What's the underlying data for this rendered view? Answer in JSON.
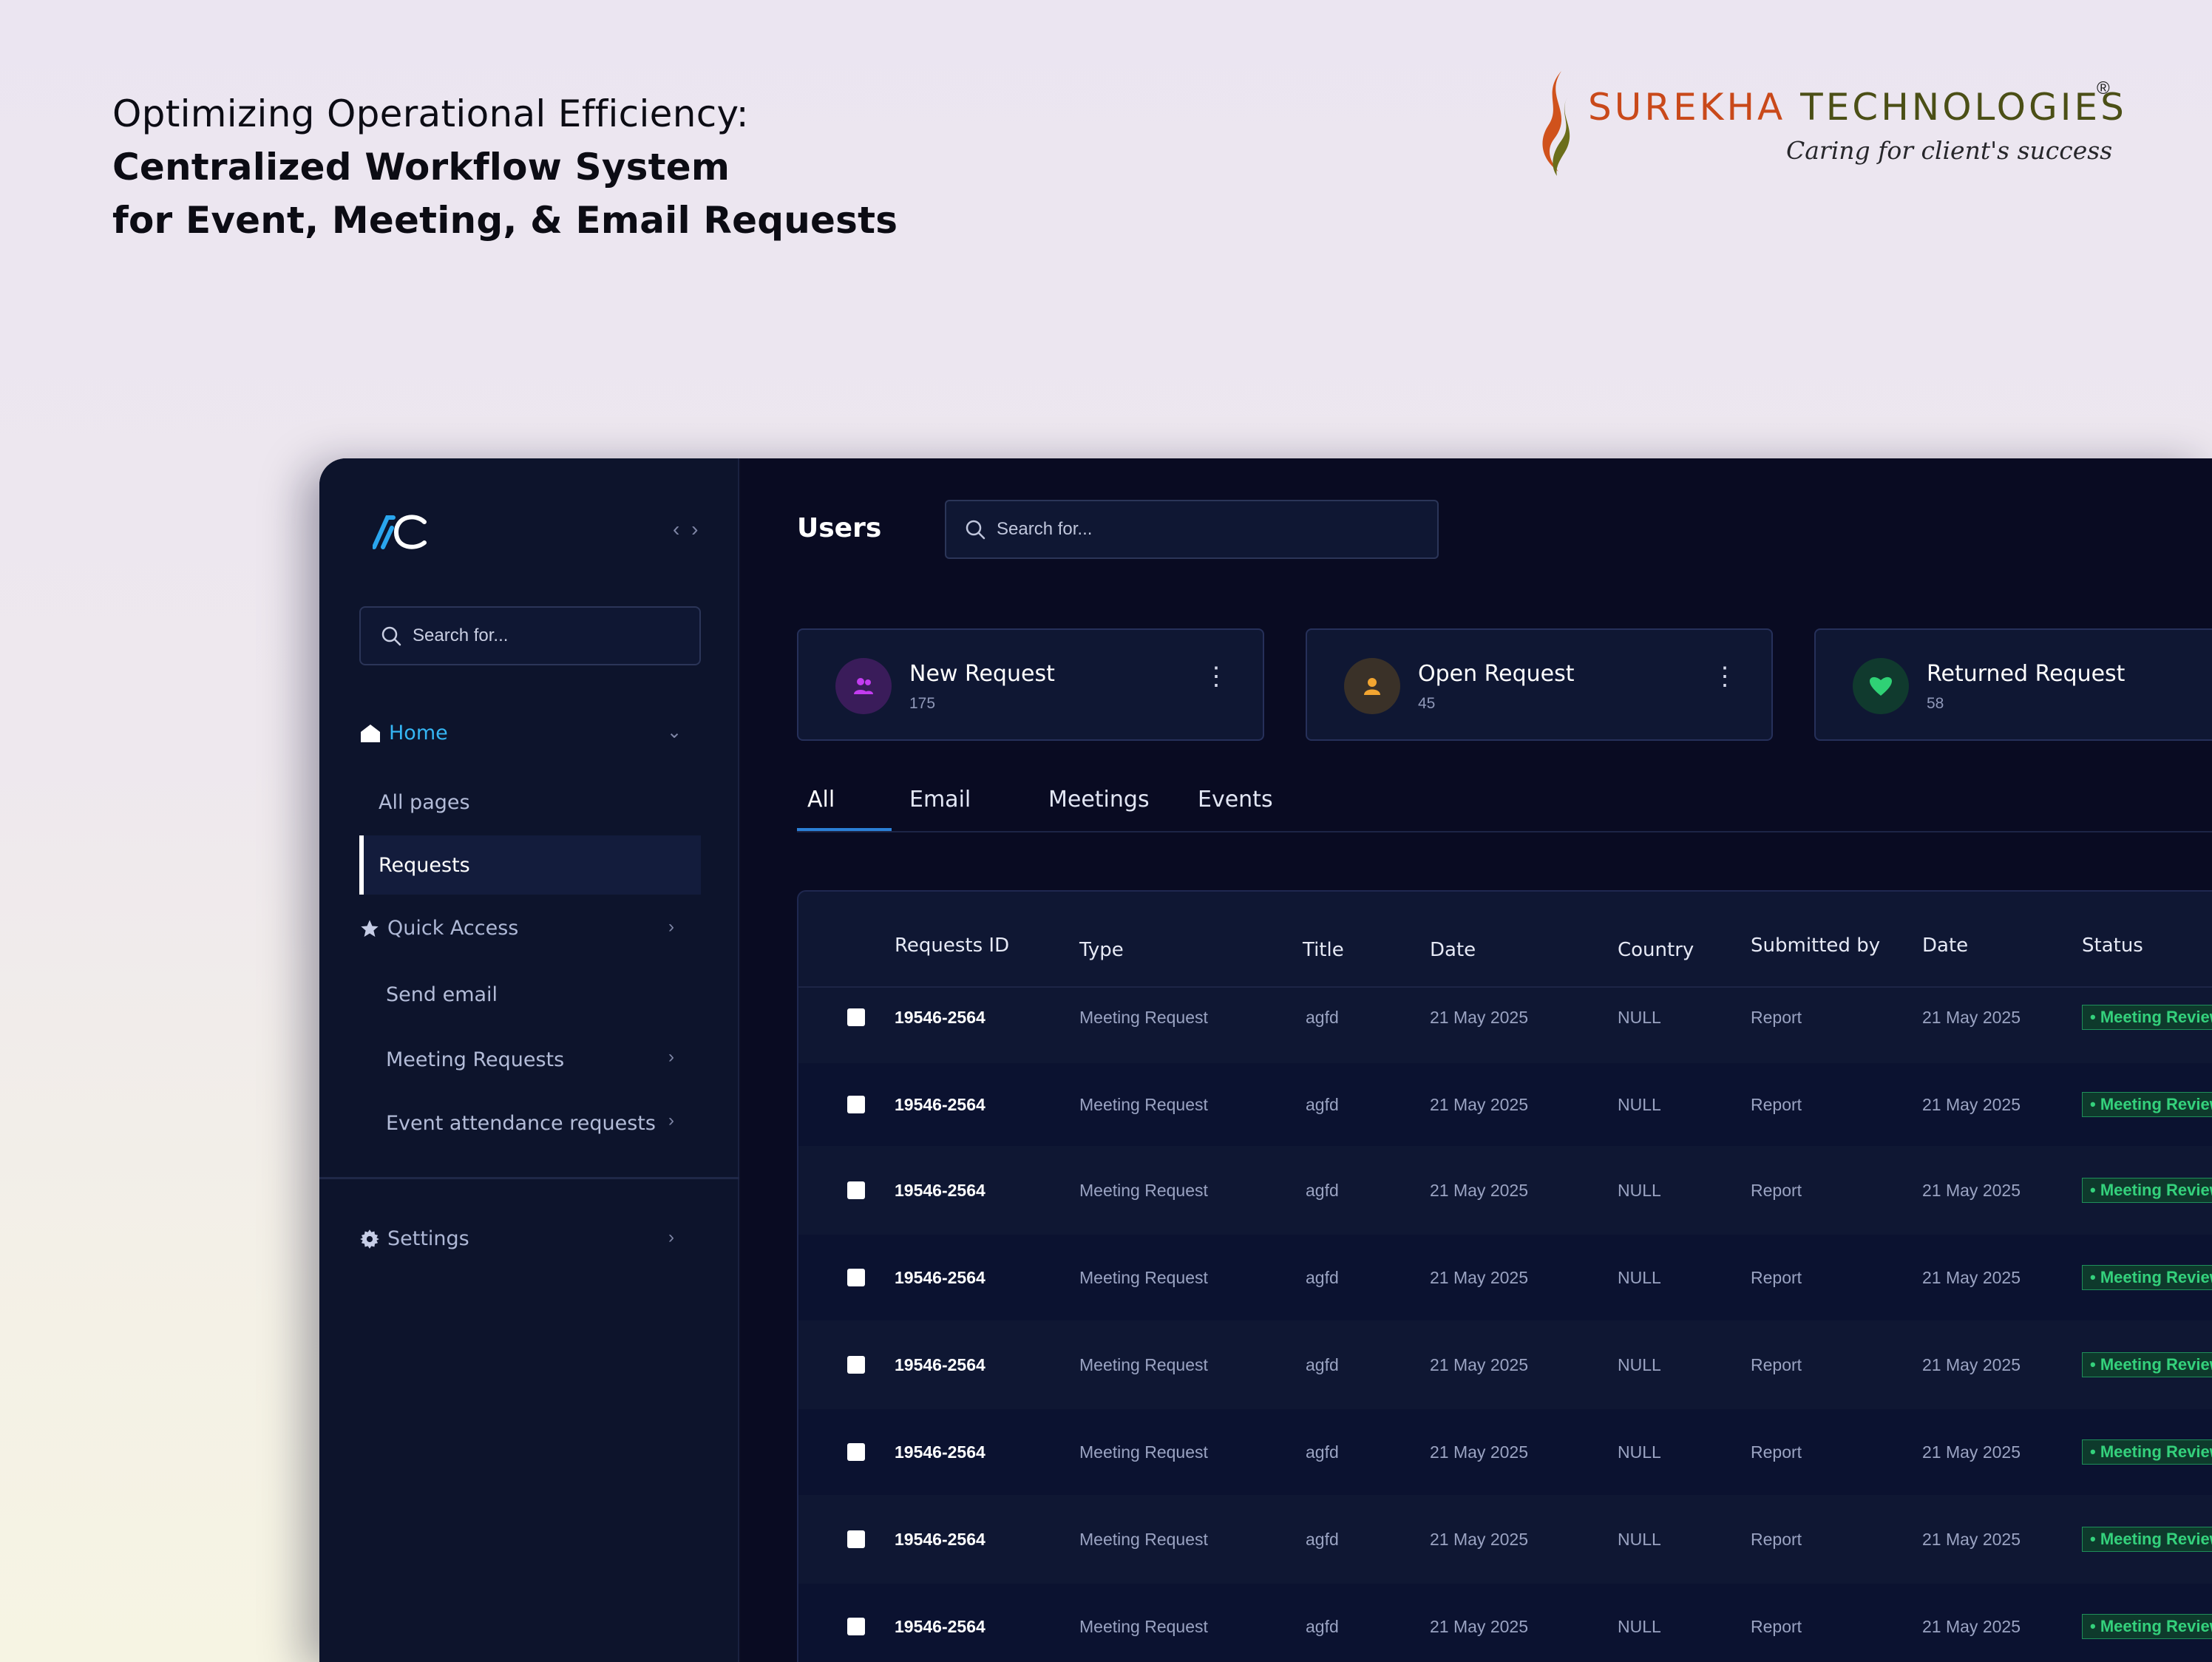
{
  "headline": {
    "line1": "Optimizing Operational Efficiency:",
    "line2": "Centralized Workflow System",
    "line3": "for Event, Meeting, & Email Requests"
  },
  "brand": {
    "name_part1": "SUREKHA",
    "name_part2": " TECHNOLOGIES",
    "registered": "®",
    "tagline": "Caring for client's success",
    "colors": {
      "primary": "#c9491a",
      "secondary": "#4b4f16"
    }
  },
  "sidebar": {
    "logo_text": "AC",
    "collapse_icon": "‹ ›",
    "search_placeholder": "Search for...",
    "home_label": "Home",
    "all_pages_label": "All pages",
    "requests_label": "Requests",
    "quick_access_label": "Quick Access",
    "send_email_label": "Send email",
    "meeting_requests_label": "Meeting Requests",
    "event_attendance_label": "Event attendance requests",
    "settings_label": "Settings"
  },
  "main": {
    "title": "Users",
    "search_placeholder": "Search for..."
  },
  "cards": [
    {
      "title": "New Request",
      "count": "175",
      "icon": "users-icon",
      "color": "#c33cf0"
    },
    {
      "title": "Open Request",
      "count": "45",
      "icon": "user-icon",
      "color": "#f2a531"
    },
    {
      "title": "Returned Request",
      "count": "58",
      "icon": "heart-icon",
      "color": "#2fd175"
    }
  ],
  "tabs": [
    "All",
    "Email",
    "Meetings",
    "Events"
  ],
  "table": {
    "headers": {
      "id": "Requests ID",
      "type": "Type",
      "title": "Title",
      "date": "Date",
      "country": "Country",
      "submitted_by": "Submitted by",
      "date2": "Date",
      "status": "Status"
    },
    "rows": [
      {
        "id": "19546-2564",
        "type": "Meeting Request",
        "title": "agfd",
        "date": "21 May 2025",
        "country": "NULL",
        "submitted_by": "Report",
        "date2": "21 May 2025",
        "status": "• Meeting Review"
      },
      {
        "id": "19546-2564",
        "type": "Meeting Request",
        "title": "agfd",
        "date": "21 May 2025",
        "country": "NULL",
        "submitted_by": "Report",
        "date2": "21 May 2025",
        "status": "• Meeting Review"
      },
      {
        "id": "19546-2564",
        "type": "Meeting Request",
        "title": "agfd",
        "date": "21 May 2025",
        "country": "NULL",
        "submitted_by": "Report",
        "date2": "21 May 2025",
        "status": "• Meeting Review"
      },
      {
        "id": "19546-2564",
        "type": "Meeting Request",
        "title": "agfd",
        "date": "21 May 2025",
        "country": "NULL",
        "submitted_by": "Report",
        "date2": "21 May 2025",
        "status": "• Meeting Review"
      },
      {
        "id": "19546-2564",
        "type": "Meeting Request",
        "title": "agfd",
        "date": "21 May 2025",
        "country": "NULL",
        "submitted_by": "Report",
        "date2": "21 May 2025",
        "status": "• Meeting Review"
      },
      {
        "id": "19546-2564",
        "type": "Meeting Request",
        "title": "agfd",
        "date": "21 May 2025",
        "country": "NULL",
        "submitted_by": "Report",
        "date2": "21 May 2025",
        "status": "• Meeting Review"
      },
      {
        "id": "19546-2564",
        "type": "Meeting Request",
        "title": "agfd",
        "date": "21 May 2025",
        "country": "NULL",
        "submitted_by": "Report",
        "date2": "21 May 2025",
        "status": "• Meeting Review"
      },
      {
        "id": "19546-2564",
        "type": "Meeting Request",
        "title": "agfd",
        "date": "21 May 2025",
        "country": "NULL",
        "submitted_by": "Report",
        "date2": "21 May 2025",
        "status": "• Meeting Review"
      }
    ]
  },
  "colors": {
    "accent": "#35b6f4",
    "status_green": "#34d17c",
    "sidebar_bg": "#0d142c",
    "main_bg": "#090b22"
  }
}
